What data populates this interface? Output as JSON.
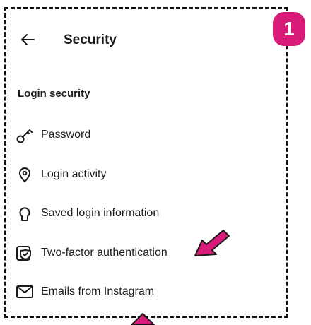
{
  "step_badge": "1",
  "header": {
    "title": "Security",
    "back_icon": "arrow-left-icon"
  },
  "section": {
    "title": "Login security"
  },
  "items": [
    {
      "label": "Password",
      "icon": "key-icon"
    },
    {
      "label": "Login activity",
      "icon": "location-pin-icon"
    },
    {
      "label": "Saved login information",
      "icon": "keyhole-icon"
    },
    {
      "label": "Two-factor authentication",
      "icon": "shield-check-icon"
    },
    {
      "label": "Emails from Instagram",
      "icon": "mail-icon"
    }
  ],
  "colors": {
    "accent": "#d81b79",
    "text": "#1d1d1d"
  }
}
